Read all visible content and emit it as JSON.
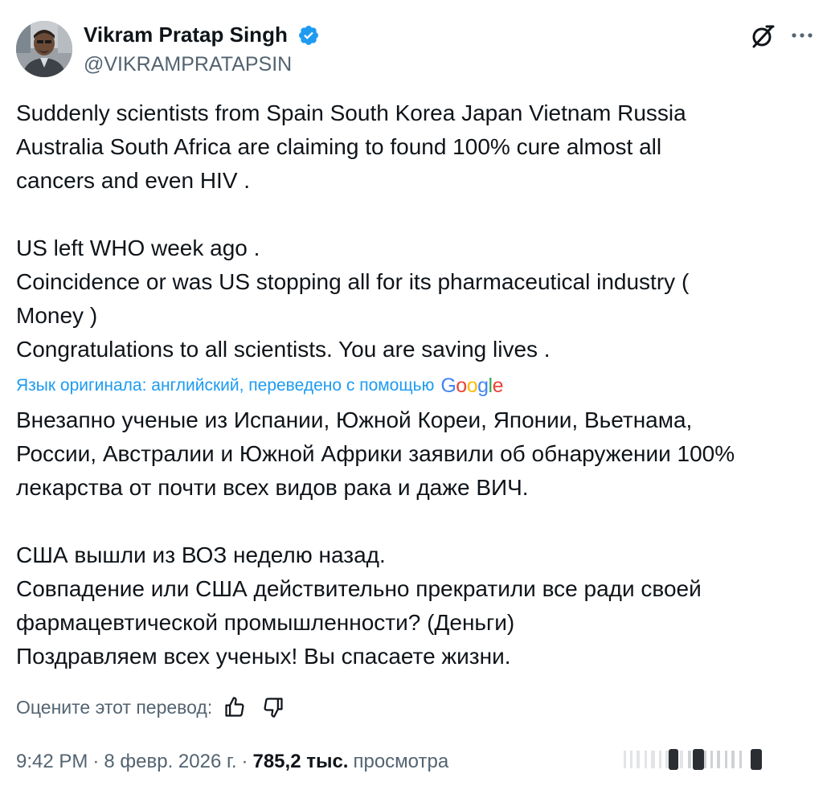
{
  "author": {
    "display_name": "Vikram Pratap Singh",
    "handle": "@VIKRAMPRATAPSIN",
    "verified": true
  },
  "header": {
    "grok_icon": "grok-icon",
    "more_icon": "more-icon"
  },
  "tweet": {
    "lines": [
      "Suddenly scientists from Spain South Korea Japan Vietnam Russia",
      "Australia South Africa are claiming to found 100% cure almost all",
      "cancers and even HIV .",
      "",
      "US left WHO week ago .",
      "Coincidence or was US stopping all for its pharmaceutical industry (",
      "Money )",
      "Congratulations to all scientists. You are saving lives ."
    ]
  },
  "translation": {
    "note": "Язык оригинала: английский, переведено с помощью",
    "provider": "Google",
    "lines": [
      "Внезапно ученые из Испании, Южной Кореи, Японии, Вьетнама,",
      "России, Австралии и Южной Африки заявили об обнаружении 100%",
      "лекарства от почти всех видов рака и даже ВИЧ.",
      "",
      "США вышли из ВОЗ неделю назад.",
      "Совпадение или США действительно прекратили все ради своей",
      "фармацевтической промышленности? (Деньги)",
      "Поздравляем всех ученых! Вы спасаете жизни."
    ],
    "rate_label": "Оцените этот перевод:",
    "thumbs_up_icon": "thumbs-up-icon",
    "thumbs_down_icon": "thumbs-down-icon"
  },
  "meta": {
    "time": "9:42 PM",
    "date": "8 февр. 2026 г.",
    "separator": "·",
    "views_count": "785,2 тыс.",
    "views_label": "просмотра"
  },
  "colors": {
    "text": "#0f1419",
    "secondary": "#536471",
    "link": "#1d9bf0",
    "verified": "#1d9bf0"
  }
}
